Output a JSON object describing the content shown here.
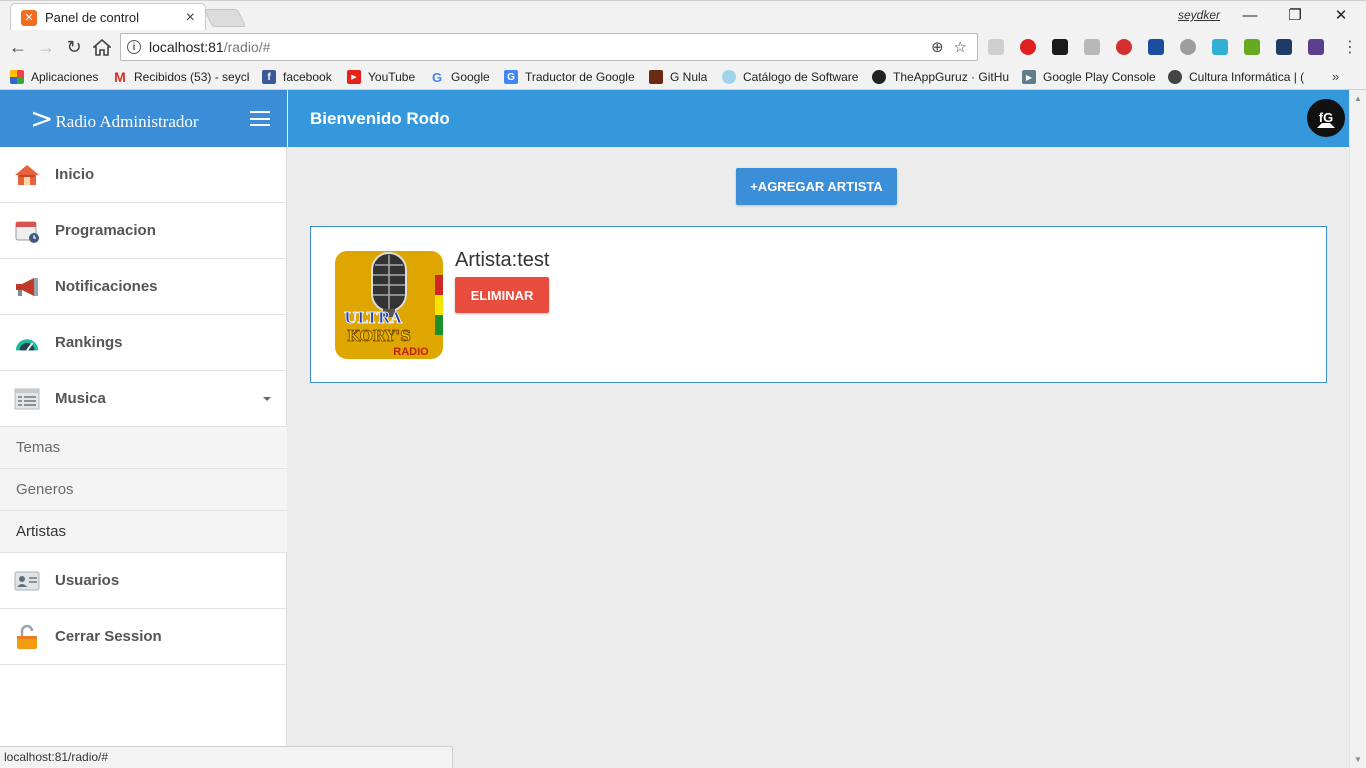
{
  "browser": {
    "tab_title": "Panel de control",
    "user": "seydker",
    "url_host": "localhost:81",
    "url_path": "/radio/#",
    "bookmarks": [
      {
        "label": "Aplicaciones",
        "icon": "apps-grid-icon"
      },
      {
        "label": "Recibidos (53) - seyck",
        "icon": "gmail-icon"
      },
      {
        "label": "facebook",
        "icon": "facebook-icon"
      },
      {
        "label": "YouTube",
        "icon": "youtube-icon"
      },
      {
        "label": "Google",
        "icon": "google-icon"
      },
      {
        "label": "Traductor de Google",
        "icon": "translate-icon"
      },
      {
        "label": "G Nula",
        "icon": "gnula-icon"
      },
      {
        "label": "Catálogo de Software",
        "icon": "catalog-icon"
      },
      {
        "label": "TheAppGuruz · GitHu",
        "icon": "github-icon"
      },
      {
        "label": "Google Play Console",
        "icon": "play-console-icon"
      },
      {
        "label": "Cultura Informática | (",
        "icon": "cultura-icon"
      }
    ],
    "status_url": "localhost:81/radio/#"
  },
  "app": {
    "brand_chevron": ">",
    "brand_title": "Radio Administrador",
    "welcome": "Bienvenido Rodo",
    "sidebar": {
      "items": [
        {
          "label": "Inicio",
          "icon": "home-icon"
        },
        {
          "label": "Programacion",
          "icon": "calendar-icon"
        },
        {
          "label": "Notificaciones",
          "icon": "megaphone-icon"
        },
        {
          "label": "Rankings",
          "icon": "gauge-icon"
        },
        {
          "label": "Musica",
          "icon": "list-icon"
        },
        {
          "label": "Usuarios",
          "icon": "id-card-icon"
        },
        {
          "label": "Cerrar Session",
          "icon": "padlock-open-icon"
        }
      ],
      "sub_items": [
        "Temas",
        "Generos",
        "Artistas"
      ],
      "active_sub_item": "Artistas"
    },
    "add_button": "+AGREGAR ARTISTA",
    "artist": {
      "name": "Artista:test",
      "delete_button": "ELIMINAR",
      "logo_text_1": "ULTRA",
      "logo_text_2": "KORY'S",
      "logo_text_3": "RADIO"
    },
    "colors": {
      "brand": "#3a8dd6",
      "header": "#3598dc",
      "primary_button": "#3a8fd8",
      "danger_button": "#e74c3c"
    }
  }
}
